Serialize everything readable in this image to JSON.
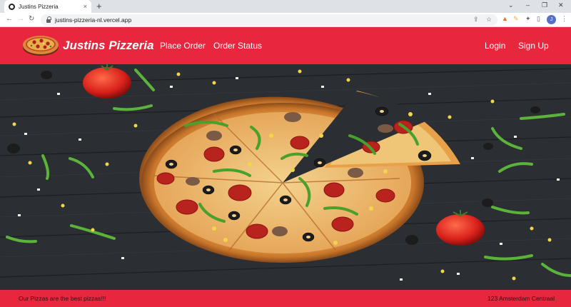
{
  "browser": {
    "tab_title": "Justins Pizzeria",
    "tab_close": "×",
    "new_tab": "+",
    "url": "justins-pizzeria-nl.vercel.app",
    "profile_initial": "J",
    "window_controls": {
      "minimize": "–",
      "restore": "❐",
      "close": "✕"
    }
  },
  "header": {
    "brand": "Justins Pizzeria",
    "nav": {
      "place_order": "Place Order",
      "order_status": "Order Status"
    },
    "auth": {
      "login": "Login",
      "signup": "Sign Up"
    }
  },
  "footer": {
    "tagline": "Our Pizzas are the best pizzas!!!",
    "address": "123 Amsterdam Centraal"
  },
  "colors": {
    "brand_red": "#e8263d",
    "board_dark": "#2a2d31"
  }
}
